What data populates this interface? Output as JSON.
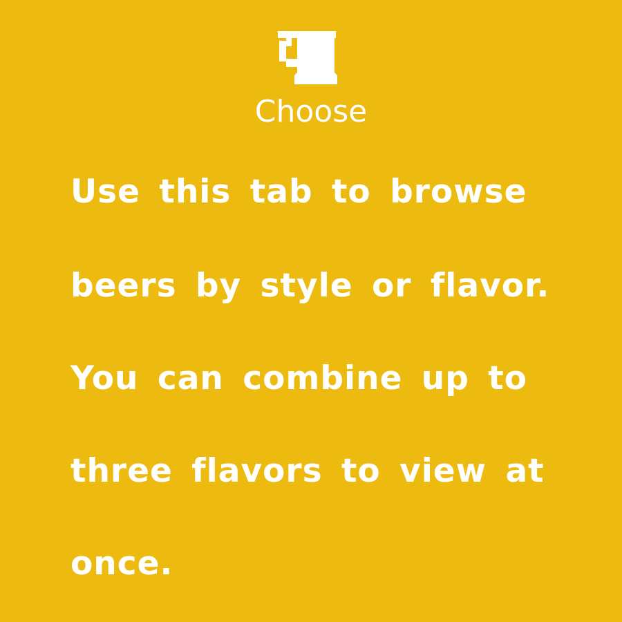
{
  "colors": {
    "background": "#EDBA10",
    "foreground": "#FFFFFF"
  },
  "header": {
    "icon": "beer-mug-icon",
    "title": "Choose"
  },
  "instructions": {
    "lines": [
      "Use this tab to browse",
      "beers by style or flavor.",
      "You can combine up to",
      "three flavors to view at",
      "once."
    ]
  }
}
